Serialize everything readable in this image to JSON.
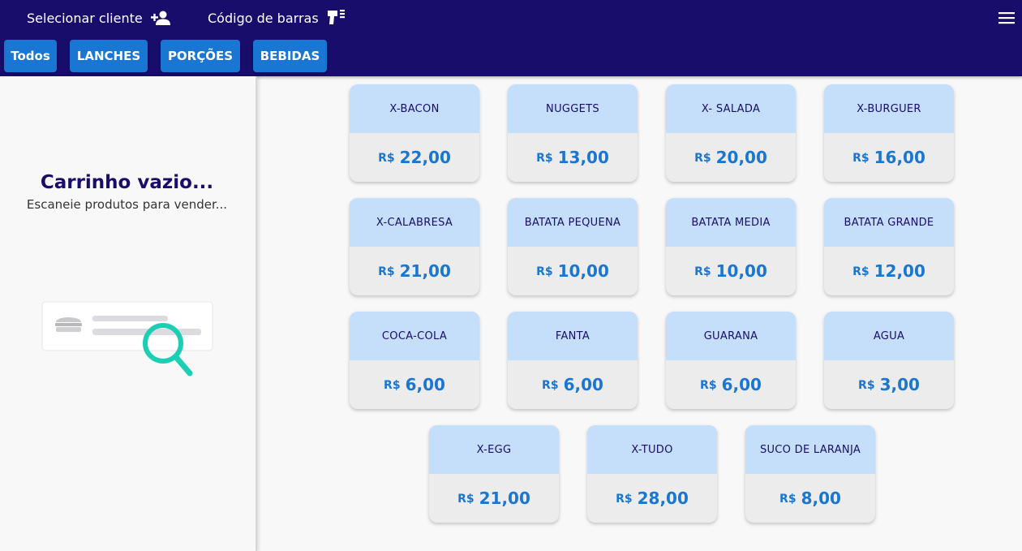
{
  "topbar": {
    "select_client_label": "Selecionar cliente",
    "select_client_icon": "person-add-icon",
    "barcode_label": "Código de barras",
    "barcode_icon": "barcode-scanner-icon",
    "menu_icon": "hamburger-menu-icon"
  },
  "categories": [
    "Todos",
    "LANCHES",
    "PORÇÕES",
    "BEBIDAS"
  ],
  "cart": {
    "empty_title": "Carrinho vazio...",
    "empty_subtitle": "Escaneie produtos para vender...",
    "illustration_icon": "empty-search-illustration"
  },
  "products": [
    {
      "name": "X-BACON",
      "currency": "R$",
      "price": "22,00"
    },
    {
      "name": "NUGGETS",
      "currency": "R$",
      "price": "13,00"
    },
    {
      "name": "X- SALADA",
      "currency": "R$",
      "price": "20,00"
    },
    {
      "name": "X-BURGUER",
      "currency": "R$",
      "price": "16,00"
    },
    {
      "name": "X-CALABRESA",
      "currency": "R$",
      "price": "21,00"
    },
    {
      "name": "BATATA PEQUENA",
      "currency": "R$",
      "price": "10,00"
    },
    {
      "name": "BATATA MEDIA",
      "currency": "R$",
      "price": "10,00"
    },
    {
      "name": "BATATA GRANDE",
      "currency": "R$",
      "price": "12,00"
    },
    {
      "name": "COCA-COLA",
      "currency": "R$",
      "price": "6,00"
    },
    {
      "name": "FANTA",
      "currency": "R$",
      "price": "6,00"
    },
    {
      "name": "GUARANA",
      "currency": "R$",
      "price": "6,00"
    },
    {
      "name": "AGUA",
      "currency": "R$",
      "price": "3,00"
    },
    {
      "name": "X-EGG",
      "currency": "R$",
      "price": "21,00"
    },
    {
      "name": "X-TUDO",
      "currency": "R$",
      "price": "28,00"
    },
    {
      "name": "SUCO DE LARANJA",
      "currency": "R$",
      "price": "8,00"
    }
  ],
  "colors": {
    "header": "#180d6b",
    "accent": "#1976d2",
    "card_header": "#c5def9",
    "search_icon": "#1ccfb4"
  }
}
